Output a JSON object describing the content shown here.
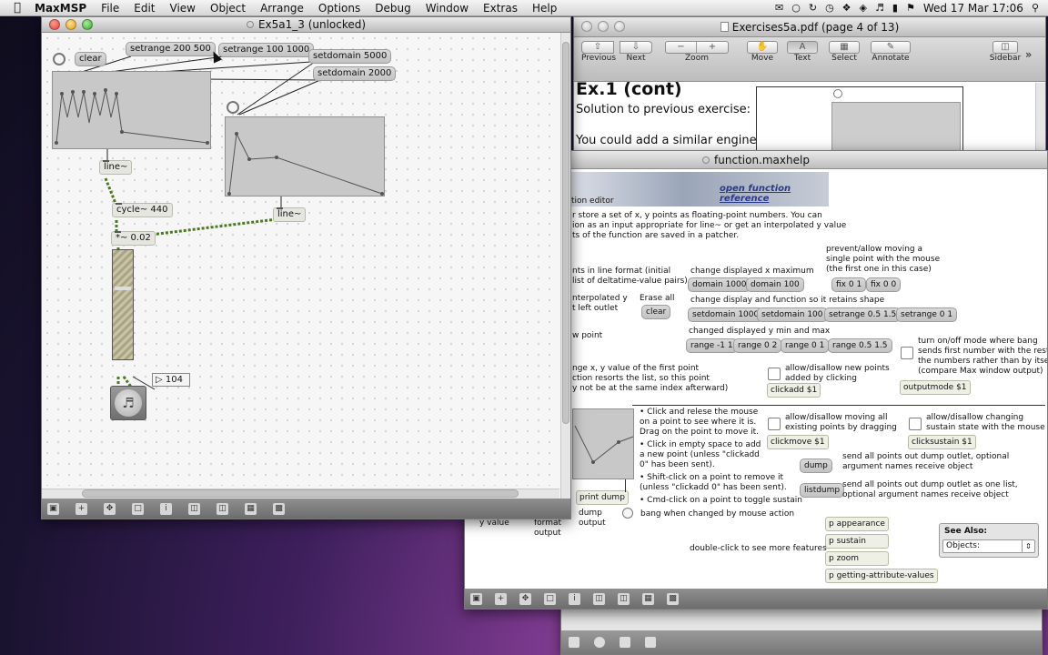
{
  "menubar": {
    "apple": "",
    "app": "MaxMSP",
    "items": [
      "File",
      "Edit",
      "View",
      "Object",
      "Arrange",
      "Options",
      "Debug",
      "Window",
      "Extras",
      "Help"
    ],
    "datetime": "Wed 17 Mar  17:06"
  },
  "patcher": {
    "title": "Ex5a1_3 (unlocked)",
    "objects": {
      "clear": "clear",
      "setrange_200_500": "setrange 200 500",
      "setrange_100_1000": "setrange 100 1000",
      "setdomain_5000": "setdomain 5000",
      "setdomain_2000": "setdomain 2000",
      "line1": "line~",
      "line2": "line~",
      "cycle": "cycle~ 440",
      "times": "*~ 0.02",
      "number": "104"
    }
  },
  "pdf": {
    "title": "Exercises5a.pdf (page 4 of 13)",
    "toolbar": {
      "previous": "Previous",
      "next": "Next",
      "zoom": "Zoom",
      "move": "Move",
      "text": "Text",
      "select": "Select",
      "annotate": "Annotate",
      "sidebar": "Sidebar"
    },
    "heading": "Ex.1 (cont)",
    "line1": "Solution to previous exercise:",
    "line2": "You could add a similar engine"
  },
  "help": {
    "title": "function.maxhelp",
    "reference_link": "open function reference",
    "header_fragment": "ction editor",
    "intro": [
      "r store a set of x, y points as floating-point numbers. You can",
      "ion as an input appropriate for line~ or get an interpolated y value",
      "ts of the function are saved in a patcher."
    ],
    "left_frag1": [
      "nts in line format (initial",
      "list of deltatime-value pairs)"
    ],
    "left_frag2": [
      "nterpolated y",
      "t left outlet"
    ],
    "left_frag3": "w point",
    "left_frag4": [
      "nge x, y value of the first point",
      "ction resorts the list, so this point",
      "y not be at the same index afterward)"
    ],
    "erase_all": "Erase all",
    "clear": "clear",
    "change_x_max": "change displayed x maximum",
    "domain1000": "domain 1000",
    "domain100": "domain 100",
    "prevent_move": [
      "prevent/allow moving a",
      "single point with the mouse",
      "(the first one in this case)"
    ],
    "fix01": "fix 0 1",
    "fix00": "fix 0 0",
    "change_display_shape": "change display and function so it retains shape",
    "setdomain1000": "setdomain 1000",
    "setdomain100": "setdomain 100",
    "setrange0515": "setrange 0.5 1.5",
    "setrange01": "setrange 0 1",
    "changed_y": "changed displayed y min and max",
    "range_11": "range -1 1",
    "range02": "range 0 2",
    "range01": "range 0 1",
    "range0515": "range 0.5 1.5",
    "outputmode_text": [
      "turn on/off mode where bang",
      "sends first number with the rest of",
      "the numbers rather than by itself",
      "(compare Max window output)"
    ],
    "outputmode": "outputmode $1",
    "allow_new": [
      "allow/disallow new points",
      "added by clicking"
    ],
    "clickadd": "clickadd $1",
    "allow_move": [
      "allow/disallow moving all",
      "existing points by dragging"
    ],
    "clickmove": "clickmove $1",
    "allow_sustain": [
      "allow/disallow changing",
      "sustain state with the mouse"
    ],
    "clicksustain": "clicksustain $1",
    "bullets": [
      "• Click and relese the mouse",
      "on a point to see where it is.",
      "Drag on the point to move it.",
      "• Click in empty space to add",
      "a new point (unless \"clickadd",
      "0\" has been sent).",
      "• Shift-click on a point to remove it",
      "(unless \"clickadd 0\" has been sent).",
      "• Cmd-click on a point to toggle sustain"
    ],
    "dump": "dump",
    "dump_desc": [
      "send all points out dump outlet, optional",
      "argument names receive object"
    ],
    "listdump": "listdump",
    "listdump_desc": [
      "send all points out dump outlet as one list,",
      "optional argument names receive object"
    ],
    "print_dump": "print dump",
    "dump_output": [
      "dump",
      "output"
    ],
    "y_value": "y value",
    "format_output": [
      "format",
      "output"
    ],
    "bang_changed": "bang when changed by mouse action",
    "p_appearance": "p appearance",
    "p_sustain": "p sustain",
    "p_zoom": "p zoom",
    "p_getting": "p getting-attribute-values",
    "double_click": "double-click to see more features",
    "see_also": "See Also:",
    "objects_select": "Objects:"
  }
}
